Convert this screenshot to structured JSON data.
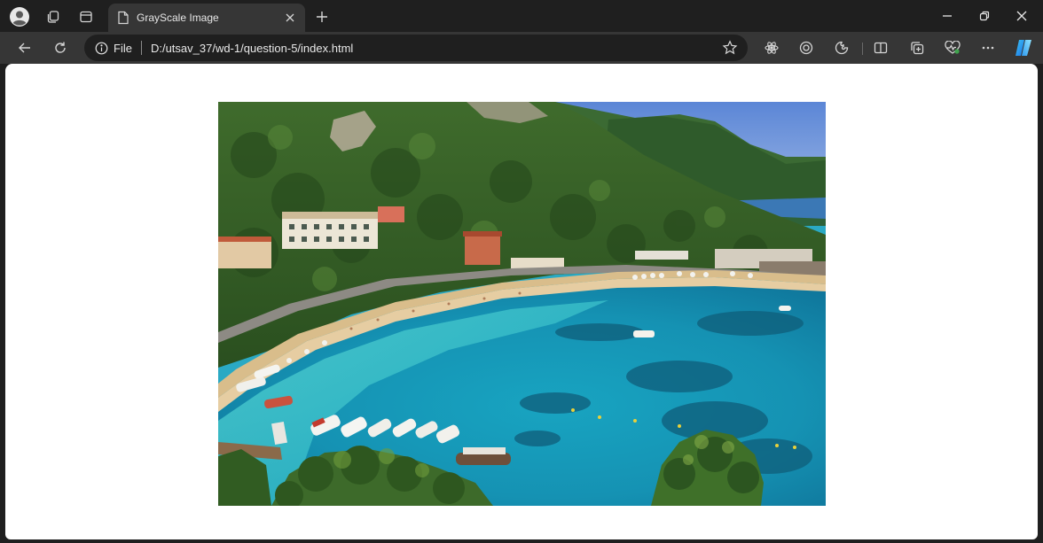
{
  "browser": {
    "tab": {
      "title": "GrayScale Image"
    },
    "address": {
      "site_label": "File",
      "url": "D:/utsav_37/wd-1/question-5/index.html"
    }
  },
  "icons": {
    "profile": "profile-avatar-icon",
    "workspaces": "workspaces-icon",
    "tab_actions": "tab-actions-icon",
    "page": "page-document-icon",
    "close": "close-icon",
    "new_tab": "plus-icon",
    "minimize": "minimize-icon",
    "restore": "restore-icon",
    "close_window": "close-window-icon",
    "back": "back-arrow-icon",
    "refresh": "refresh-icon",
    "info": "info-icon",
    "favorite": "star-icon",
    "extensions": [
      "atom-icon",
      "target-icon",
      "puzzle-icon",
      "split-screen-icon",
      "collections-icon",
      "heart-pulse-icon",
      "more-icon",
      "copilot-icon"
    ]
  },
  "colors": {
    "chrome_dark": "#1f1f1f",
    "toolbar": "#363636",
    "page_bg": "#ffffff",
    "copilot_accent": "#2f9bf0"
  }
}
